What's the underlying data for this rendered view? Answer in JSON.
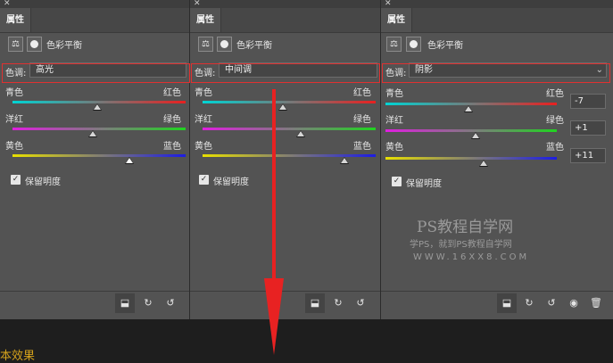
{
  "panels": [
    {
      "tab": "属性",
      "header_title": "色彩平衡",
      "tone_label": "色调:",
      "tone_value": "高光",
      "sliders": [
        {
          "left": "青色",
          "right": "红色",
          "value": 0
        },
        {
          "left": "洋红",
          "right": "绿色",
          "value": -6
        },
        {
          "left": "黄色",
          "right": "蓝色",
          "value": 37
        }
      ],
      "preserve_luminosity": "保留明度"
    },
    {
      "tab": "属性",
      "header_title": "色彩平衡",
      "tone_label": "色调:",
      "tone_value": "中间调",
      "sliders": [
        {
          "left": "青色",
          "right": "红色",
          "value": 8
        },
        {
          "left": "洋红",
          "right": "绿色",
          "value": 11
        },
        {
          "left": "黄色",
          "right": "蓝色",
          "value": 62
        }
      ],
      "preserve_luminosity": "保留明度"
    },
    {
      "tab": "属性",
      "header_title": "色彩平衡",
      "tone_label": "色调:",
      "tone_value": "阴影",
      "sliders": [
        {
          "left": "青色",
          "right": "红色",
          "value": -7,
          "display": "-7"
        },
        {
          "left": "洋红",
          "right": "绿色",
          "value": 1,
          "display": "+1"
        },
        {
          "left": "黄色",
          "right": "蓝色",
          "value": 11,
          "display": "+11"
        }
      ],
      "preserve_luminosity": "保留明度"
    }
  ],
  "icons": {
    "balance": "⚖",
    "clip": "⬓",
    "visibility": "↻",
    "reset": "↺",
    "eye": "◉",
    "trash": "🗑"
  },
  "watermark": {
    "line1": "PS教程自学网",
    "line2": "学PS，就到PS教程自学网",
    "line3": "WWW.16XX8.COM"
  },
  "bottom_text": "本效果"
}
